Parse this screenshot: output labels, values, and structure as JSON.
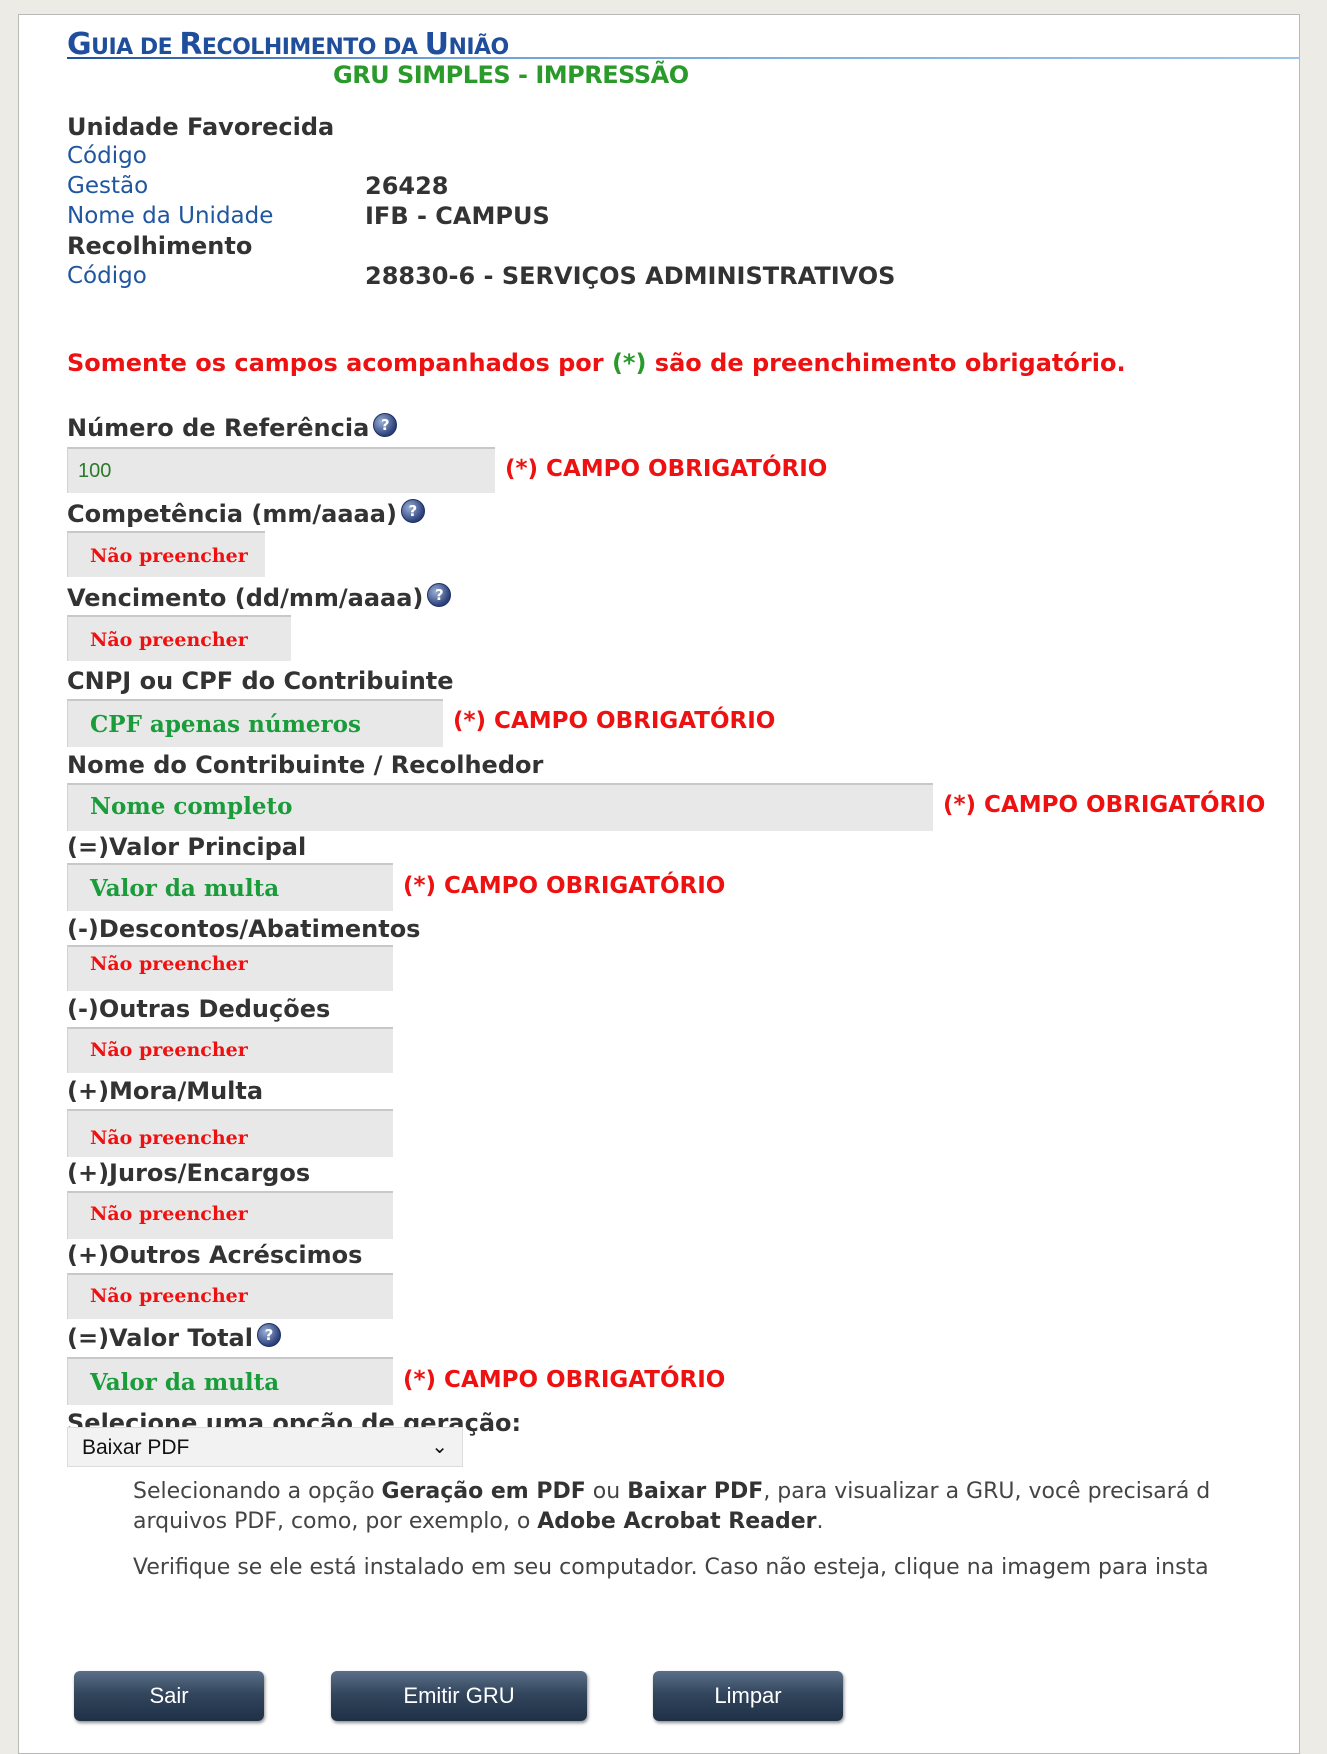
{
  "header": {
    "title_g": "G",
    "title_uia": "UIA DE ",
    "title_r": "R",
    "title_ecolhimento": "ECOLHIMENTO DA ",
    "title_u": "U",
    "title_niao": "NIÃO",
    "subtitle": "GRU SIMPLES - IMPRESSÃO"
  },
  "unidade": {
    "heading": "Unidade Favorecida",
    "codigo_label": "Código",
    "gestao_label": "Gestão",
    "gestao_value": "26428",
    "nome_label": "Nome da Unidade",
    "nome_value": "IFB - CAMPUS"
  },
  "recolhimento": {
    "heading": "Recolhimento",
    "codigo_label": "Código",
    "codigo_value": "28830-6 - SERVIÇOS ADMINISTRATIVOS"
  },
  "notice": {
    "pre": "Somente os campos acompanhados por ",
    "asterisk": "(*)",
    "post": " são de preenchimento obrigatório."
  },
  "required_text": "(*) CAMPO OBRIGATÓRIO",
  "help_glyph": "?",
  "fields": {
    "numero_referencia": {
      "label": "Número de Referência",
      "value": "100"
    },
    "competencia": {
      "label": "Competência (mm/aaaa)",
      "placeholder": "Não preencher"
    },
    "vencimento": {
      "label": "Vencimento (dd/mm/aaaa)",
      "placeholder": "Não preencher"
    },
    "cnpj_cpf": {
      "label": "CNPJ ou CPF do Contribuinte",
      "placeholder": "CPF apenas números"
    },
    "nome_contribuinte": {
      "label": "Nome do Contribuinte / Recolhedor",
      "placeholder": "Nome completo"
    },
    "valor_principal": {
      "label": "(=)Valor Principal",
      "placeholder": "Valor da multa"
    },
    "descontos": {
      "label": "(-)Descontos/Abatimentos",
      "placeholder": "Não preencher"
    },
    "outras_deducoes": {
      "label": "(-)Outras Deduções",
      "placeholder": "Não preencher"
    },
    "mora_multa": {
      "label": "(+)Mora/Multa",
      "placeholder": "Não preencher"
    },
    "juros": {
      "label": "(+)Juros/Encargos",
      "placeholder": "Não preencher"
    },
    "outros_acrescimos": {
      "label": "(+)Outros Acréscimos",
      "placeholder": "Não preencher"
    },
    "valor_total": {
      "label": "(=)Valor Total",
      "placeholder": "Valor da multa"
    }
  },
  "geracao": {
    "label": "Selecione uma opção de geração:",
    "selected": "Baixar PDF",
    "chevron": "⌄",
    "info1_a": "Selecionando a opção ",
    "info1_b": "Geração em PDF",
    "info1_c": " ou ",
    "info1_d": "Baixar PDF",
    "info1_e": ", para visualizar a GRU, você precisará d",
    "info2_a": "arquivos PDF, como, por exemplo, o ",
    "info2_b": "Adobe Acrobat Reader",
    "info2_c": ".",
    "info3": "Verifique se ele está instalado em seu computador. Caso não esteja, clique na imagem para insta"
  },
  "buttons": {
    "sair": "Sair",
    "emitir": "Emitir GRU",
    "limpar": "Limpar"
  },
  "colors": {
    "title_blue": "#1f4e9c",
    "subtitle_green": "#2a9b2a",
    "required_red": "#ee1111",
    "placeholder_green": "#1a9c3a",
    "button_dark": "#2b3d54"
  }
}
